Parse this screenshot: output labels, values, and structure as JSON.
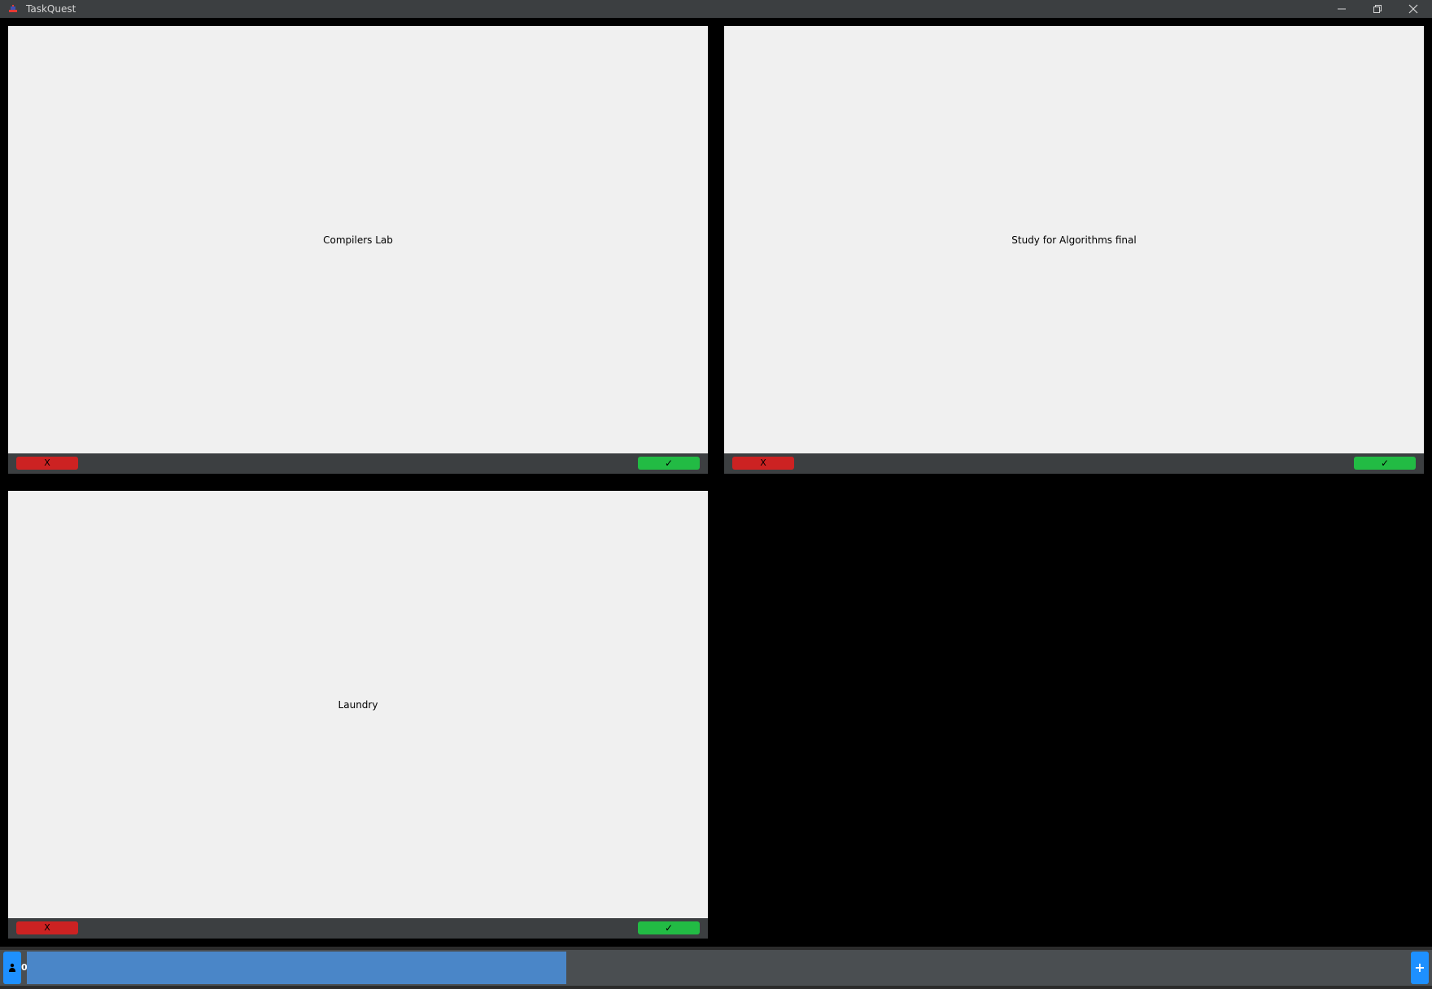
{
  "window": {
    "title": "TaskQuest"
  },
  "icons": {
    "app": "app-icon",
    "minimize": "minimize-icon",
    "restore": "restore-icon",
    "close": "close-icon",
    "user": "user-icon",
    "add": "plus-icon"
  },
  "tasks": [
    {
      "title": "Compilers Lab",
      "reject_label": "X",
      "accept_label": "✓"
    },
    {
      "title": "Study for Algorithms final",
      "reject_label": "X",
      "accept_label": "✓"
    },
    {
      "title": "Laundry",
      "reject_label": "X",
      "accept_label": "✓"
    }
  ],
  "footer": {
    "points": "0",
    "progress": 0.39,
    "add_label": "+"
  },
  "colors": {
    "titlebar": "#3c3f41",
    "card": "#f0f0f0",
    "reject": "#cc2222",
    "accept": "#22bb44",
    "accent": "#1e90ff",
    "progress_fill": "#4a86c8",
    "progress_track": "#4a4e51",
    "background": "#000000"
  }
}
